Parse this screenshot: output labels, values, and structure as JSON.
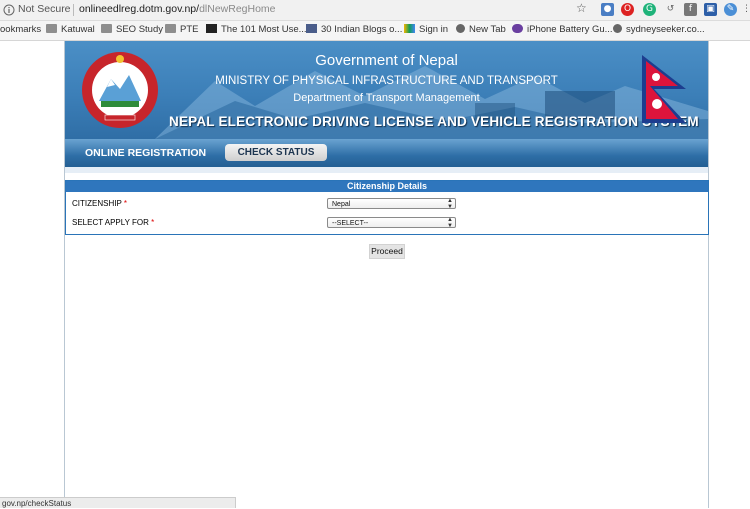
{
  "browser": {
    "security_label": "Not Secure",
    "url_host": "onlineedlreg.dotm.gov.np/",
    "url_path": "dlNewRegHome",
    "status_url": "gov.np/checkStatus"
  },
  "bookmarks": [
    {
      "label": "ookmarks"
    },
    {
      "label": "Katuwal"
    },
    {
      "label": "SEO Study"
    },
    {
      "label": "PTE"
    },
    {
      "label": "The 101 Most Use..."
    },
    {
      "label": "30 Indian Blogs o..."
    },
    {
      "label": "Sign in"
    },
    {
      "label": "New Tab"
    },
    {
      "label": "iPhone Battery Gu..."
    },
    {
      "label": "sydneyseeker.co..."
    }
  ],
  "banner": {
    "title": "Government of Nepal",
    "ministry": "MINISTRY OF PHYSICAL INFRASTRUCTURE AND TRANSPORT",
    "department": "Department of Transport Management",
    "system": "NEPAL ELECTRONIC DRIVING LICENSE AND VEHICLE REGISTRATION SYSTEM"
  },
  "nav": {
    "online_registration": "ONLINE REGISTRATION",
    "check_status": "CHECK STATUS"
  },
  "form": {
    "section_title": "Citizenship Details",
    "required_mark": "*",
    "citizenship": {
      "label": "CITIZENSHIP",
      "value": "Nepal"
    },
    "apply_for": {
      "label": "SELECT APPLY FOR",
      "value": "--SELECT--"
    },
    "proceed_label": "Proceed"
  },
  "colors": {
    "banner_blue": "#3c7fb8",
    "header_blue": "#2f76bd",
    "required_red": "#d00000"
  }
}
